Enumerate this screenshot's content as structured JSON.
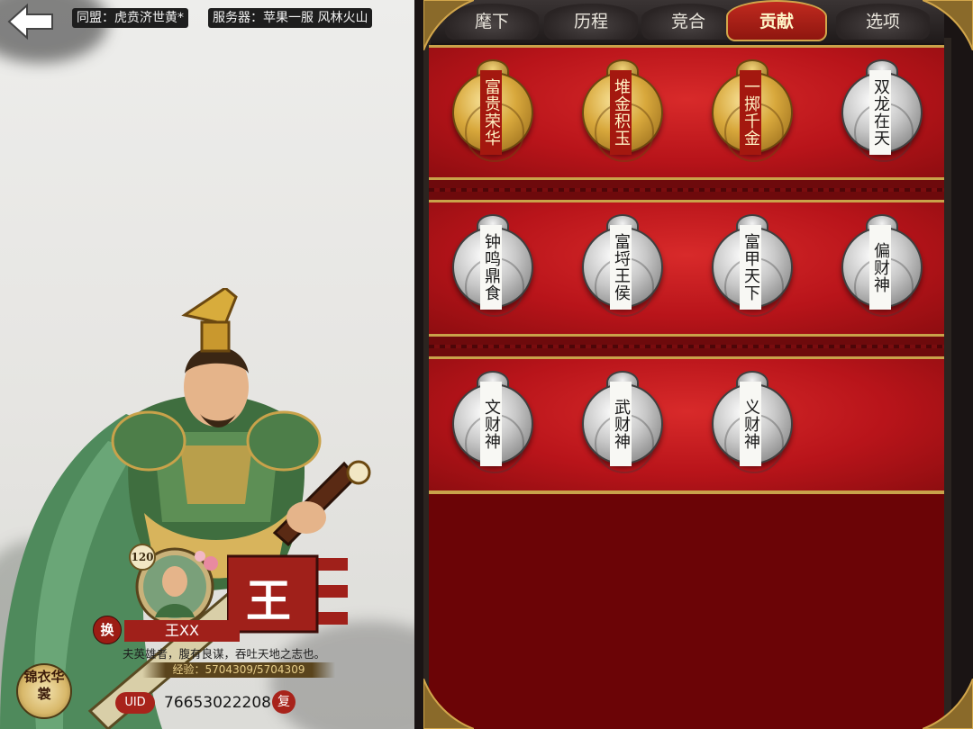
{
  "header": {
    "back_icon": "back-arrow-icon",
    "alliance": "同盟：虎贲济世黄*",
    "server": "服务器：苹果一服 风林火山"
  },
  "tabs": [
    {
      "label": "麾下",
      "active": false
    },
    {
      "label": "历程",
      "active": false
    },
    {
      "label": "竞合",
      "active": false
    },
    {
      "label": "贡献",
      "active": true
    },
    {
      "label": "选项",
      "active": false
    }
  ],
  "medals": [
    [
      {
        "text": "富贵荣华",
        "tier": "gold"
      },
      {
        "text": "堆金积玉",
        "tier": "gold"
      },
      {
        "text": "一掷千金",
        "tier": "gold"
      },
      {
        "text": "双龙在天",
        "tier": "silver"
      }
    ],
    [
      {
        "text": "钟鸣鼎食",
        "tier": "silver"
      },
      {
        "text": "富埒王侯",
        "tier": "silver"
      },
      {
        "text": "富甲天下",
        "tier": "silver"
      },
      {
        "text": "偏财神",
        "tier": "silver"
      }
    ],
    [
      {
        "text": "文财神",
        "tier": "silver"
      },
      {
        "text": "武财神",
        "tier": "silver"
      },
      {
        "text": "义财神",
        "tier": "silver"
      }
    ]
  ],
  "profile": {
    "level": "120",
    "surname_glyph": "王",
    "swap_label": "换",
    "name": "王XX",
    "motto": "夫英雄者，腹有良谋，吞吐天地之志也。",
    "exp_text": "经验：5704309/5704309",
    "uid_label": "UID",
    "uid_value": "76653022208",
    "copy_label": "复",
    "outfit_label": "锦衣华裳"
  },
  "colors": {
    "accent_red": "#a8231b",
    "gold": "#c9a24a",
    "panel_red": "#b8141a"
  }
}
